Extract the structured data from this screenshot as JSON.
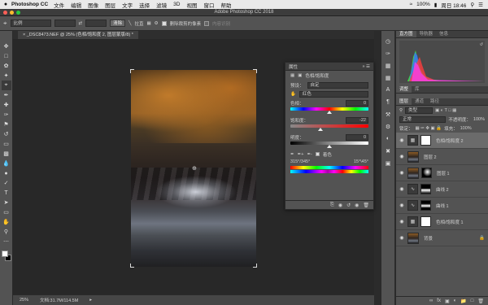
{
  "macbar": {
    "apple": "",
    "app_name": "Photoshop CC",
    "menus": [
      "文件",
      "编辑",
      "图像",
      "图层",
      "文字",
      "选择",
      "滤镜",
      "3D",
      "视图",
      "窗口",
      "帮助"
    ],
    "battery": "100%",
    "clock": "周日 18:46"
  },
  "window": {
    "title": "Adobe Photoshop CC 2018"
  },
  "options": {
    "ratio_label": "比例",
    "clear_label": "清除",
    "straighten_label": "拉直",
    "delete_cropped_label": "删除裁剪的像素",
    "content_aware_label": "内容识别"
  },
  "document": {
    "tab_label": "_DSC8473.NEF @ 25% (色相/饱和度 2, 图层蒙版/8) *"
  },
  "status": {
    "zoom": "25%",
    "doc_info": "文档:31.7M/114.5M"
  },
  "properties": {
    "title": "属性",
    "adjustment_title": "色相/饱和度",
    "preset_label": "预设：",
    "preset_value": "自定",
    "channel_value": "红色",
    "hue_label": "色相：",
    "hue_value": "0",
    "hue_fraction": 0.5,
    "sat_label": "饱和度：",
    "sat_value": "-22",
    "sat_fraction": 0.39,
    "light_label": "明度：",
    "light_value": "0",
    "light_fraction": 0.5,
    "colorize_label": "着色",
    "range_left": "315°/345°",
    "range_right": "15°\\45°"
  },
  "right_panel": {
    "top_tabs": [
      "直方图",
      "导航器",
      "信息"
    ],
    "layer_tabs": [
      "调整",
      "库"
    ],
    "layer_sub_tabs": [
      "图层",
      "通道",
      "路径"
    ],
    "kind_label": "类型",
    "blend_mode": "正常",
    "opacity_label": "不透明度：",
    "opacity_value": "100%",
    "lock_label": "锁定：",
    "fill_label": "填充：",
    "fill_value": "100%",
    "layers": [
      {
        "name": "色相/饱和度 2",
        "selected": true
      },
      {
        "name": "图层 2",
        "selected": false
      },
      {
        "name": "图层 1",
        "selected": false
      },
      {
        "name": "曲线 2",
        "selected": false
      },
      {
        "name": "曲线 1",
        "selected": false
      },
      {
        "name": "色相/饱和度 1",
        "selected": false
      },
      {
        "name": "背景",
        "selected": false
      }
    ]
  }
}
